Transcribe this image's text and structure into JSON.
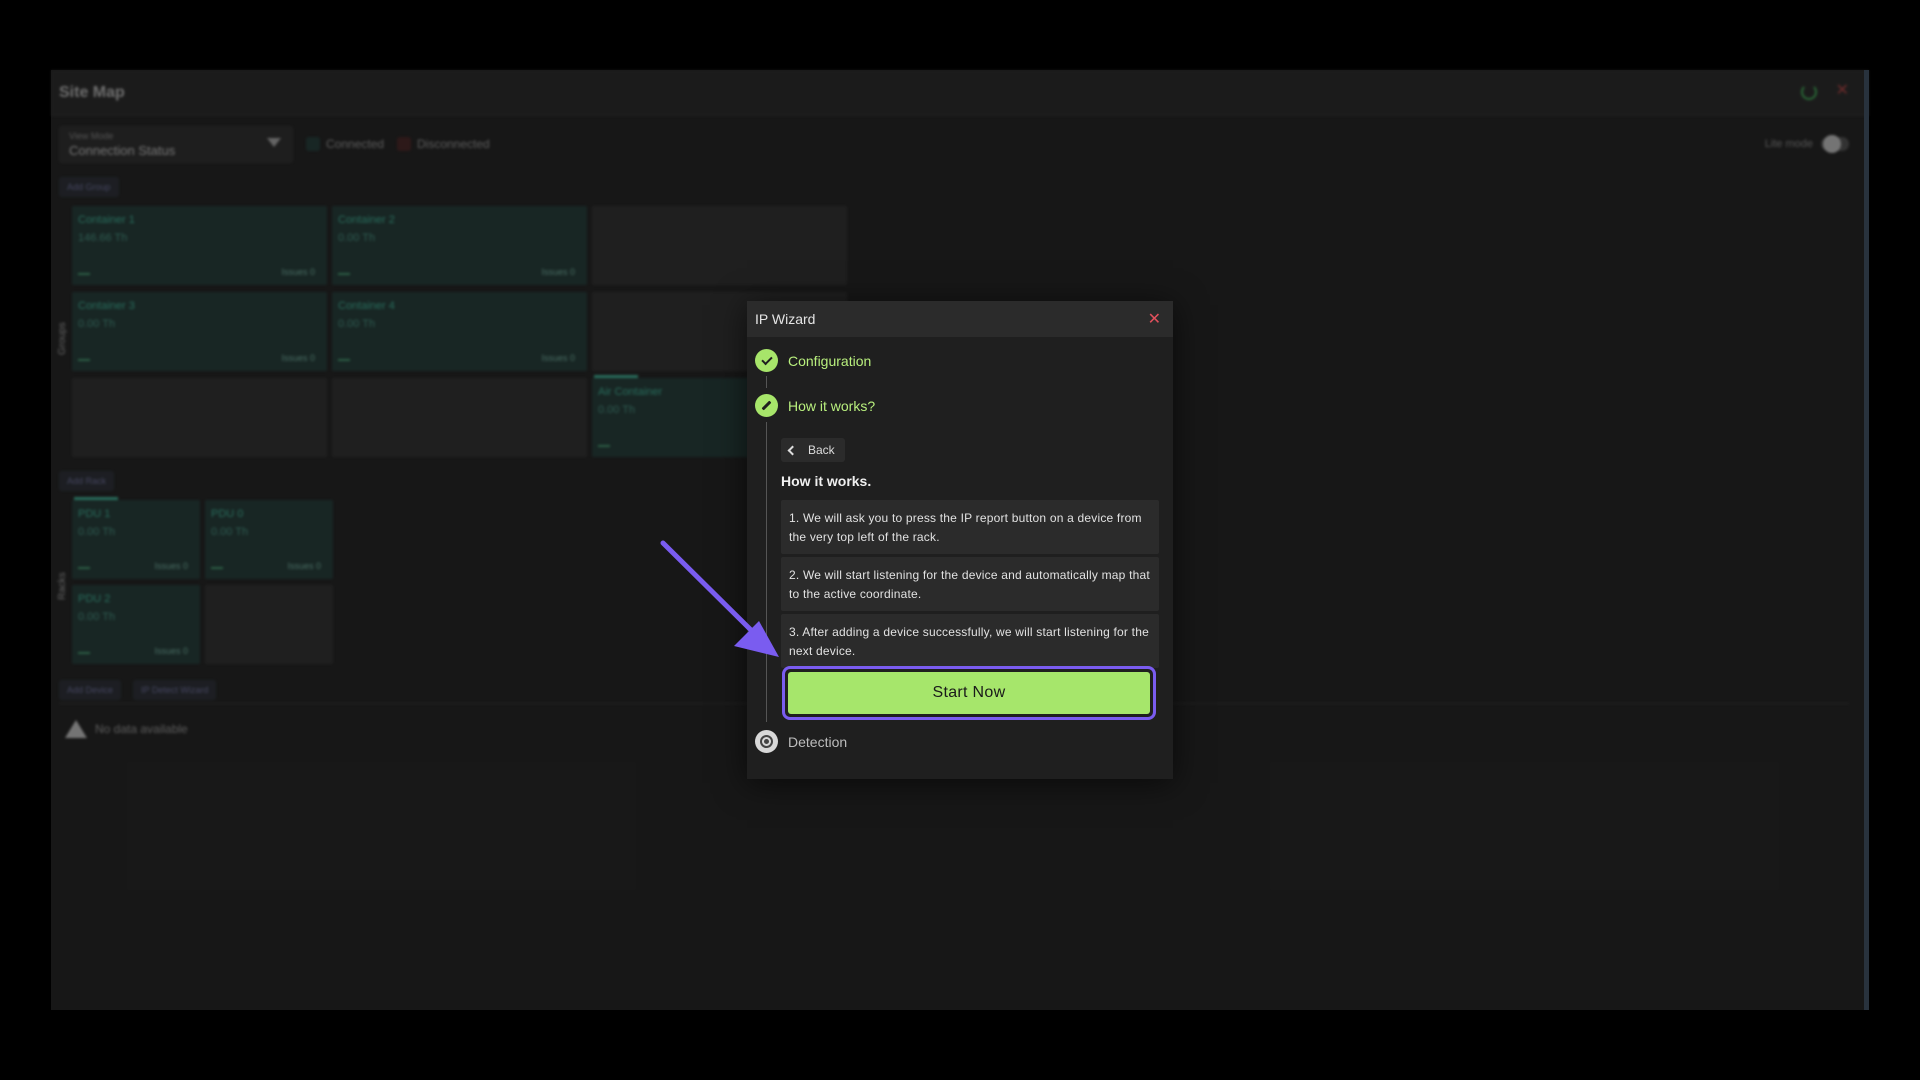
{
  "app": {
    "title": "Site Map",
    "view_mode_label": "View Mode",
    "view_mode_value": "Connection Status",
    "legend_connected": "Connected",
    "legend_disconnected": "Disconnected",
    "lite_mode_label": "Lite mode",
    "add_group_label": "Add Group",
    "groups_label": "Groups",
    "add_rack_label": "Add Rack",
    "racks_label": "Racks",
    "add_device_label": "Add Device",
    "ip_detect_wizard_label": "IP Detect Wizard",
    "no_data_text": "No data available",
    "groups": [
      {
        "name": "Container 1",
        "value": "146.66 Th",
        "dash": "---",
        "issues": "Issues 0"
      },
      {
        "name": "Container 2",
        "value": "0.00 Th",
        "dash": "---",
        "issues": "Issues 0"
      },
      {
        "name": "Container 3",
        "value": "0.00 Th",
        "dash": "---",
        "issues": "Issues 0"
      },
      {
        "name": "Container 4",
        "value": "0.00 Th",
        "dash": "---",
        "issues": "Issues 0"
      },
      {
        "name": "Air Container",
        "value": "0.00 Th",
        "dash": "---",
        "issues": ""
      }
    ],
    "racks": [
      {
        "name": "PDU 1",
        "value": "0.00 Th",
        "dash": "---",
        "issues": "Issues 0"
      },
      {
        "name": "PDU 0",
        "value": "0.00 Th",
        "dash": "---",
        "issues": "Issues 0"
      },
      {
        "name": "PDU 2",
        "value": "0.00 Th",
        "dash": "---",
        "issues": "Issues 0"
      }
    ],
    "colors": {
      "connected": "#1d3a36",
      "disconnected": "#4a1f1f",
      "accent": "#3ec9a7"
    }
  },
  "wizard": {
    "title": "IP Wizard",
    "steps": [
      {
        "label": "Configuration",
        "state": "done"
      },
      {
        "label": "How it works?",
        "state": "active"
      },
      {
        "label": "Detection",
        "state": "pending"
      }
    ],
    "back_label": "Back",
    "heading": "How it works.",
    "instructions": [
      "1. We will ask you to press the IP report button on a device from the very top left of the rack.",
      "2. We will start listening for the device and automatically map that to the active coordinate.",
      "3. After adding a device successfully, we will start listening for the next device."
    ],
    "start_label": "Start Now",
    "colors": {
      "accent": "#a6e66b",
      "highlight": "#7a5cf0",
      "close": "#e0505c"
    }
  }
}
